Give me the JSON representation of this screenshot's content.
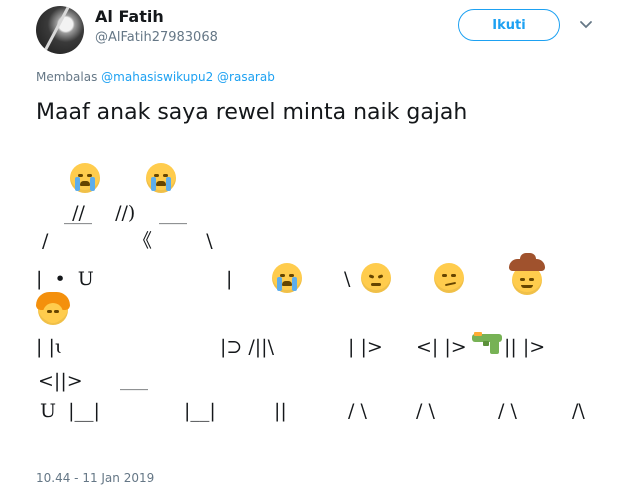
{
  "author": {
    "name": "Al Fatih",
    "handle": "@AlFatih27983068"
  },
  "header": {
    "follow_label": "Ikuti",
    "menu_icon": "chevron-down-icon"
  },
  "reply": {
    "prefix": "Membalas",
    "mentions": [
      "@mahasiswikupu2",
      "@rasarab"
    ]
  },
  "tweet": {
    "text": "Maaf anak saya rewel minta naik gajah",
    "ascii_art": [
      "  //     //)",
      "/              《         \\",
      "|  •  U",
      "|",
      "\\",
      "| |ɩ",
      "|⊃ /||\\",
      "| |>",
      "<| |>",
      "|| |>",
      "<||>",
      "U  |__|",
      "|__|",
      "||",
      "/ \\",
      "/ \\",
      "/ \\",
      "/\\",
      "____",
      "____",
      "____",
      "____"
    ],
    "emojis": [
      "crying-face-icon",
      "crying-face-icon",
      "crying-face-icon",
      "angry-face-icon",
      "smirking-face-icon",
      "cowboy-face-icon",
      "girl-face-icon",
      "water-pistol-icon"
    ]
  },
  "timestamp": "10.44 - 11 Jan 2019"
}
